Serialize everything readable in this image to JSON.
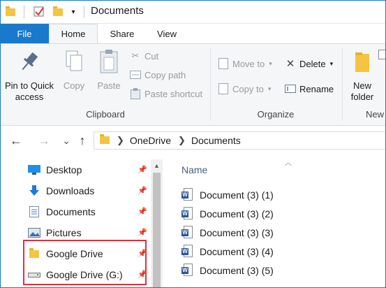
{
  "titlebar": {
    "title": "Documents",
    "icons": [
      "folder-icon",
      "properties-checkmark-icon",
      "new-folder-icon",
      "customize-dropdown-icon"
    ]
  },
  "ribbon": {
    "tabs": [
      {
        "label": "File"
      },
      {
        "label": "Home"
      },
      {
        "label": "Share"
      },
      {
        "label": "View"
      }
    ],
    "clipboard": {
      "label": "Clipboard",
      "pin_line1": "Pin to Quick",
      "pin_line2": "access",
      "copy": "Copy",
      "paste": "Paste",
      "cut": "Cut",
      "copy_path": "Copy path",
      "paste_shortcut": "Paste shortcut"
    },
    "organize": {
      "label": "Organize",
      "move_to": "Move to",
      "copy_to": "Copy to",
      "delete": "Delete",
      "rename": "Rename"
    },
    "new": {
      "label": "New",
      "new_folder_line1": "New",
      "new_folder_line2": "folder"
    }
  },
  "address": {
    "back_icon": "←",
    "forward_icon": "→",
    "recent_icon": "⌄",
    "up_icon": "↑",
    "crumbs": [
      "OneDrive",
      "Documents"
    ]
  },
  "nav": {
    "items": [
      {
        "label": "Desktop",
        "icon": "desktop-icon"
      },
      {
        "label": "Downloads",
        "icon": "downloads-icon"
      },
      {
        "label": "Documents",
        "icon": "documents-icon"
      },
      {
        "label": "Pictures",
        "icon": "pictures-icon"
      },
      {
        "label": "Google Drive",
        "icon": "folder-icon"
      },
      {
        "label": "Google Drive (G:)",
        "icon": "drive-icon"
      }
    ]
  },
  "files": {
    "column_name": "Name",
    "rows": [
      {
        "name": "Document (3) (1)"
      },
      {
        "name": "Document (3) (2)"
      },
      {
        "name": "Document (3) (3)"
      },
      {
        "name": "Document (3) (4)"
      },
      {
        "name": "Document (3) (5)"
      }
    ]
  },
  "colors": {
    "accent": "#1979ca",
    "highlight": "#e0303c",
    "folder": "#f4c542"
  }
}
